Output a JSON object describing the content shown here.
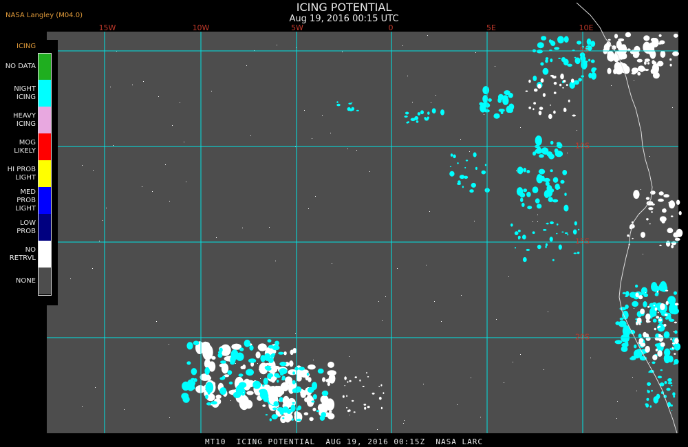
{
  "header": {
    "title": "ICING POTENTIAL",
    "subtitle": "Aug 19, 2016 00:15 UTC",
    "agency": "NASA Langley (M04.0)"
  },
  "map": {
    "longitude_labels": [
      "15W",
      "10W",
      "5W",
      "0",
      "5E",
      "10E"
    ],
    "latitude_labels": [
      "5S",
      "10S",
      "15S",
      "20S"
    ],
    "colors": {
      "background": "#4d4d4d",
      "grid": "#00e5e5",
      "coastline": "#e0e0e0",
      "night_icing": "#00ffff",
      "no_retrieval": "#ffffff"
    }
  },
  "legend": {
    "title": "ICING",
    "items": [
      {
        "label": "NO DATA",
        "color": "#1fae1f"
      },
      {
        "label": "NIGHT\nICING",
        "color": "#00ffff"
      },
      {
        "label": "HEAVY\nICING",
        "color": "#e8a8e0"
      },
      {
        "label": "MOG\nLIKELY",
        "color": "#ff0000"
      },
      {
        "label": "HI PROB\nLIGHT",
        "color": "#ffff00"
      },
      {
        "label": "MED PROB\nLIGHT",
        "color": "#0000ff"
      },
      {
        "label": "LOW\nPROB",
        "color": "#000080"
      },
      {
        "label": "NO\nRETRVL",
        "color": "#ffffff"
      },
      {
        "label": "NONE",
        "color": "#4d4d4d"
      }
    ]
  },
  "footer": {
    "text": "MT10  ICING POTENTIAL  AUG 19, 2016 00:15Z  NASA LARC"
  }
}
